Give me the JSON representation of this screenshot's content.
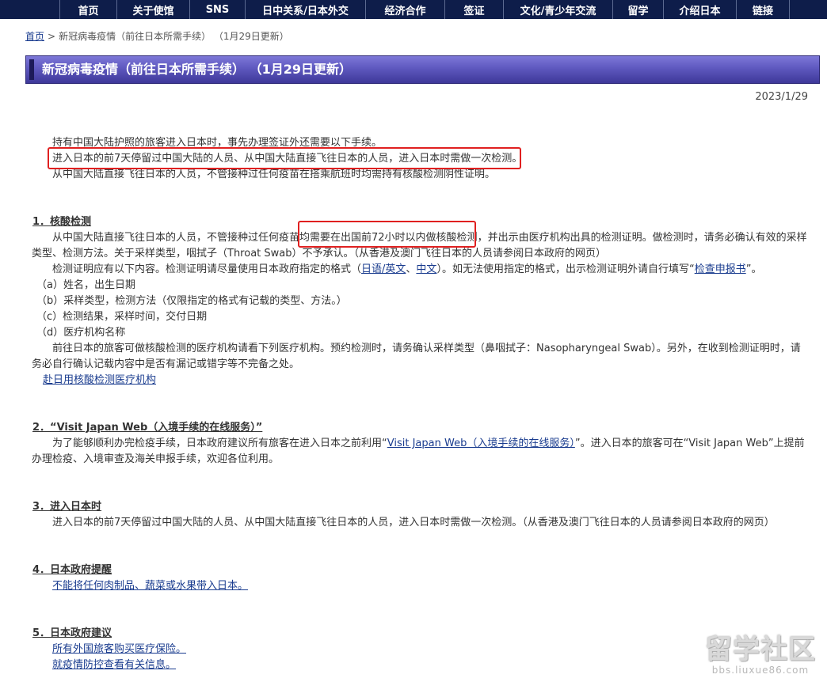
{
  "nav": {
    "items": [
      "首页",
      "关于使馆",
      "SNS",
      "日中关系/日本外交",
      "经济合作",
      "签证",
      "文化/青少年交流",
      "留学",
      "介绍日本",
      "链接"
    ]
  },
  "breadcrumb": {
    "home": "首页",
    "separator": ">",
    "current": "新冠病毒疫情（前往日本所需手续） （1月29日更新）"
  },
  "page": {
    "title": "新冠病毒疫情（前往日本所需手续） （1月29日更新）",
    "date": "2023/1/29"
  },
  "intro": {
    "l1": "持有中国大陆护照的旅客进入日本时，事先办理签证外还需要以下手续。",
    "l2": "进入日本的前7天停留过中国大陆的人员、从中国大陆直接飞往日本的人员，进入日本时需做一次检测。",
    "l3": "从中国大陆直接飞往日本的人员，不管接种过任何疫苗在搭乘航班时均需持有核酸检测阴性证明。"
  },
  "s1": {
    "heading": "1．核酸检测",
    "p1a": "从中国大陆直接飞往日本的人员，不管接种过任何疫苗均",
    "p1b": "需要在出国前72小时以内做核酸检测",
    "p1c": "，并出示由医疗机构出具的检测证明。做检测时，请务必确认有效的采样类型、检测方法。关于采样类型，咽拭子（Throat Swab）不予承认。（从香港及澳门飞往日本的人员请参阅日本政府的网页）",
    "p2a": "检测证明应有以下内容。检测证明请尽量使用日本政府指定的格式（",
    "p2_link1": "日语/英文",
    "p2_sep": "、",
    "p2_link2": "中文",
    "p2b": "）。如无法使用指定的格式，出示检测证明外请自行填写“",
    "p2_link3": "检查申报书",
    "p2c": "”。",
    "items": [
      "（a）姓名，出生日期",
      "（b）采样类型，检测方法（仅限指定的格式有记载的类型、方法。）",
      "（c）检测结果，采样时间，交付日期",
      "（d）医疗机构名称"
    ],
    "p3": "前往日本的旅客可做核酸检测的医疗机构请看下列医疗机构。预约检测时，请务确认采样类型（鼻咽拭子：Nasopharyngeal Swab）。另外，在收到检测证明时，请务必自行确认记载内容中是否有漏记或错字等不完备之处。",
    "link": "赴日用核酸检测医疗机构"
  },
  "s2": {
    "heading": "2．“Visit Japan Web（入境手续的在线服务）”",
    "pa": "为了能够顺利办完检疫手续，日本政府建议所有旅客在进入日本之前利用“",
    "link": "Visit Japan Web（入境手续的在线服务）",
    "pb": "”。进入日本的旅客可在“Visit Japan Web”上提前办理检疫、入境审查及海关申报手续，欢迎各位利用。"
  },
  "s3": {
    "heading": "3．进入日本时",
    "text": "进入日本的前7天停留过中国大陆的人员、从中国大陆直接飞往日本的人员，进入日本时需做一次检测。（从香港及澳门飞往日本的人员请参阅日本政府的网页）"
  },
  "s4": {
    "heading": "4．日本政府提醒",
    "link": "不能将任何肉制品、蔬菜或水果带入日本。"
  },
  "s5": {
    "heading": "5．日本政府建议",
    "link1": "所有外国旅客购买医疗保险。",
    "link2": "就疫情防控查看有关信息。"
  },
  "watermark": {
    "main": "留学社区",
    "sub": "bbs.liuxue86.com"
  },
  "colors": {
    "nav_bg": "#0e1d4a",
    "title_bar": "#5e58bf",
    "link": "#1a3c8f",
    "highlight_box": "#e02020"
  }
}
